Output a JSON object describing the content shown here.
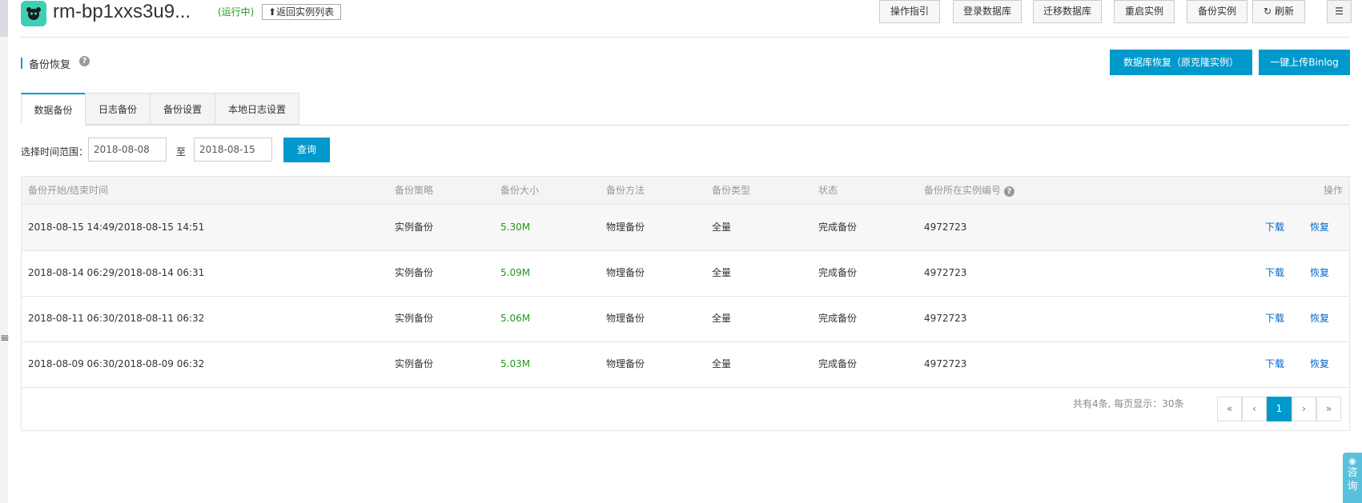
{
  "header": {
    "instance_name": "rm-bp1xxs3u9...",
    "status": "(运行中)",
    "back_label": "返回实例列表",
    "toolbar": [
      "操作指引",
      "登录数据库",
      "迁移数据库",
      "重启实例",
      "备份实例",
      "刷新"
    ]
  },
  "section": {
    "title": "备份恢复",
    "help": "?",
    "restore_button": "数据库恢复（原克隆实例）",
    "upload_button": "一键上传Binlog"
  },
  "tabs": [
    "数据备份",
    "日志备份",
    "备份设置",
    "本地日志设置"
  ],
  "filter": {
    "label": "选择时间范围：",
    "start": "2018-08-08",
    "to": "至",
    "end": "2018-08-15",
    "query": "查询"
  },
  "table": {
    "columns": [
      "备份开始/结束时间",
      "备份策略",
      "备份大小",
      "备份方法",
      "备份类型",
      "状态",
      "备份所在实例编号",
      "操作"
    ],
    "rows": [
      {
        "time": "2018-08-15 14:49/2018-08-15 14:51",
        "policy": "实例备份",
        "size": "5.30M",
        "method": "物理备份",
        "type": "全量",
        "status": "完成备份",
        "instance": "4972723",
        "download": "下载",
        "restore": "恢复"
      },
      {
        "time": "2018-08-14 06:29/2018-08-14 06:31",
        "policy": "实例备份",
        "size": "5.09M",
        "method": "物理备份",
        "type": "全量",
        "status": "完成备份",
        "instance": "4972723",
        "download": "下载",
        "restore": "恢复"
      },
      {
        "time": "2018-08-11 06:30/2018-08-11 06:32",
        "policy": "实例备份",
        "size": "5.06M",
        "method": "物理备份",
        "type": "全量",
        "status": "完成备份",
        "instance": "4972723",
        "download": "下载",
        "restore": "恢复"
      },
      {
        "time": "2018-08-09 06:30/2018-08-09 06:32",
        "policy": "实例备份",
        "size": "5.03M",
        "method": "物理备份",
        "type": "全量",
        "status": "完成备份",
        "instance": "4972723",
        "download": "下载",
        "restore": "恢复"
      }
    ]
  },
  "pager": {
    "info": "共有4条, 每页显示：30条",
    "first": "«",
    "prev": "‹",
    "current": "1",
    "next": "›",
    "last": "»"
  },
  "consult": "咨询",
  "colors": {
    "primary": "#0099cc",
    "success": "#1e9a1e",
    "link": "#0066cc",
    "logo": "#3fcfb6"
  }
}
